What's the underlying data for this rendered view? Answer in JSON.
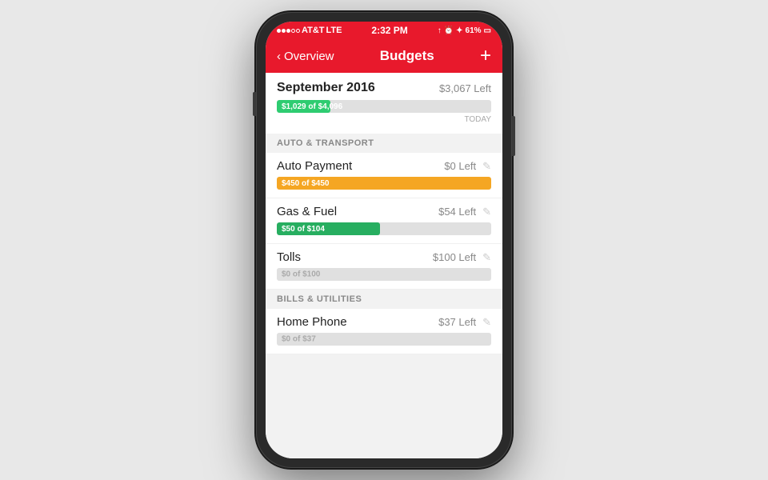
{
  "phone": {
    "status": {
      "carrier": "AT&T",
      "network": "LTE",
      "time": "2:32 PM",
      "battery": "61%"
    },
    "nav": {
      "back_label": "Overview",
      "title": "Budgets",
      "add_label": "+"
    },
    "september": {
      "title": "September 2016",
      "left": "$3,067 Left",
      "progress_label": "$1,029 of $4,096",
      "progress_pct": 25,
      "today_label": "TODAY",
      "fill_color": "#2ecc71"
    },
    "categories": [
      {
        "name": "AUTO & TRANSPORT",
        "items": [
          {
            "name": "Auto Payment",
            "left": "$0 Left",
            "progress_label": "$450 of $450",
            "progress_pct": 100,
            "fill_color": "#f5a623"
          },
          {
            "name": "Gas & Fuel",
            "left": "$54 Left",
            "progress_label": "$50 of $104",
            "progress_pct": 48,
            "fill_color": "#27ae60"
          },
          {
            "name": "Tolls",
            "left": "$100 Left",
            "progress_label": "$0 of $100",
            "progress_pct": 0,
            "fill_color": "#e0e0e0"
          }
        ]
      },
      {
        "name": "BILLS & UTILITIES",
        "items": [
          {
            "name": "Home Phone",
            "left": "$37 Left",
            "progress_label": "$0 of $37",
            "progress_pct": 0,
            "fill_color": "#e0e0e0"
          }
        ]
      }
    ]
  }
}
